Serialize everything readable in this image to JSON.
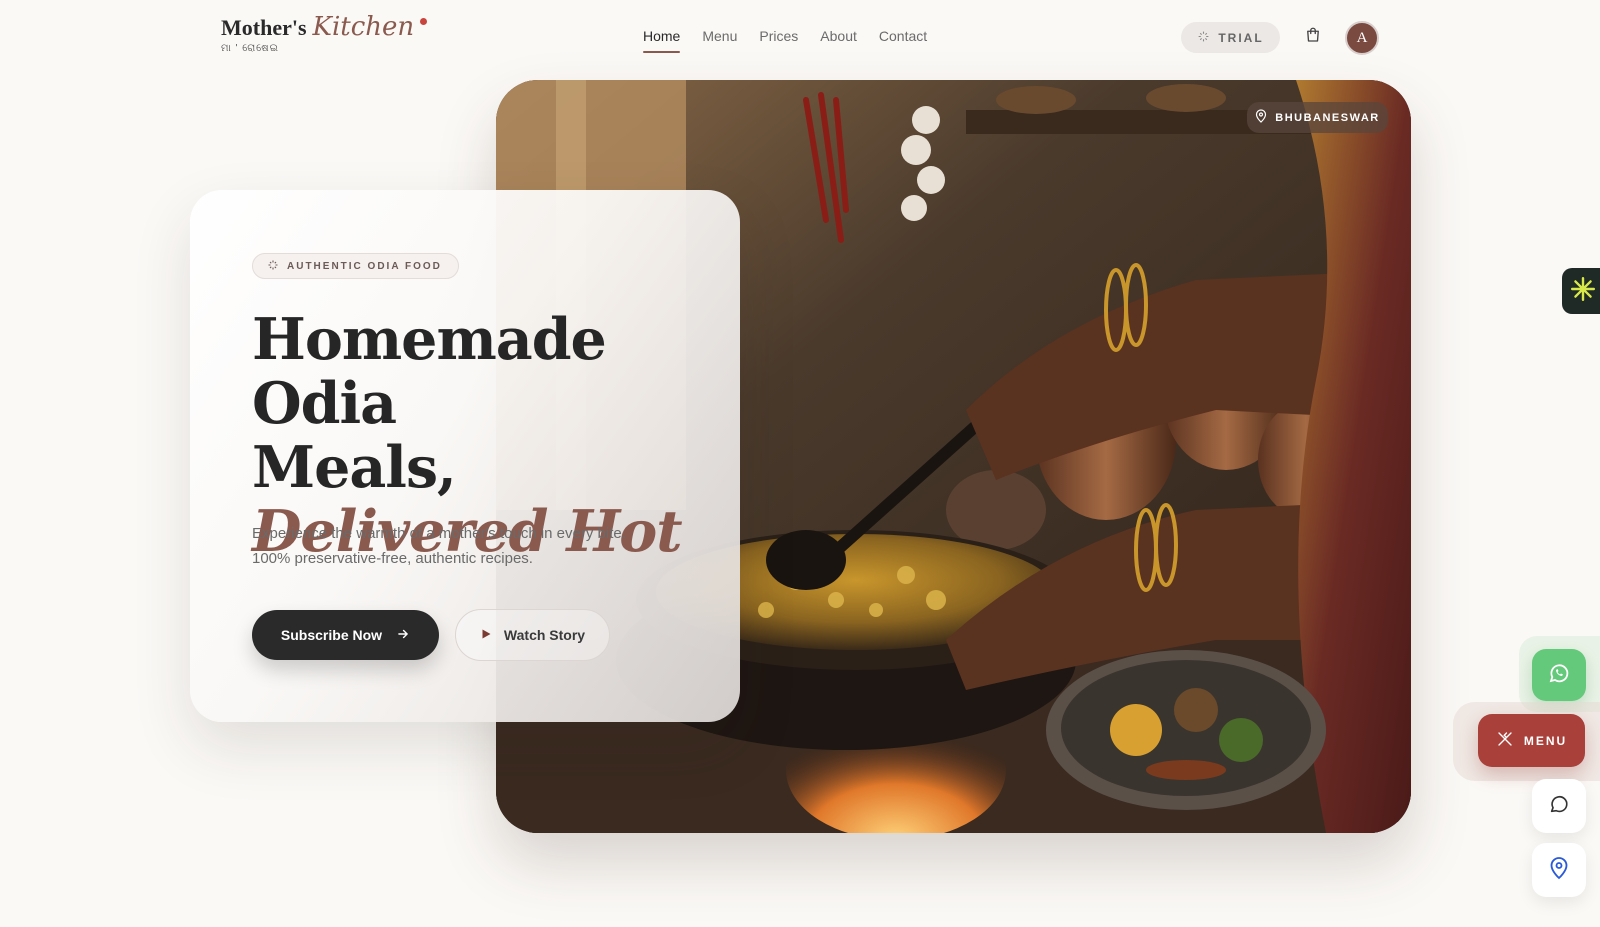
{
  "brand": {
    "name": "Mother's",
    "script": "Kitchen",
    "subtitle": "ମା ' ରୋଷେଇ",
    "accent_color": "#8a5a4e",
    "dot_color": "#c8453e"
  },
  "nav": {
    "items": [
      "Home",
      "Menu",
      "Prices",
      "About",
      "Contact"
    ],
    "active": "Home"
  },
  "header": {
    "trial_label": "TRIAL",
    "trial_icon": "sparkle-icon",
    "cart_icon": "shopping-bag-icon",
    "avatar_initial": "A"
  },
  "hero": {
    "location_label": "BHUBANESWAR",
    "location_icon": "map-pin-icon",
    "image_subject": "kitchen-cooking-photo"
  },
  "card": {
    "badge": "AUTHENTIC ODIA FOOD",
    "headline_line1": "Homemade Odia",
    "headline_line2": "Meals,",
    "headline_accent": "Delivered Hot",
    "description_line1": "Experience the warmth of a mother's touch in every bite.",
    "description_line2": "100% preservative-free, authentic recipes.",
    "primary_cta": "Subscribe Now",
    "secondary_cta": "Watch Story"
  },
  "floating": {
    "menu_label": "MENU",
    "whatsapp_icon": "whatsapp-icon",
    "chat_icon": "chat-bubble-icon",
    "location_icon": "map-pin-icon",
    "widget_icon": "asterisk-icon",
    "whatsapp_color": "#64c97a",
    "menu_color": "#a9403a"
  },
  "colors": {
    "page_bg": "#fbf9f6",
    "primary_dark": "#2a2a2a"
  }
}
